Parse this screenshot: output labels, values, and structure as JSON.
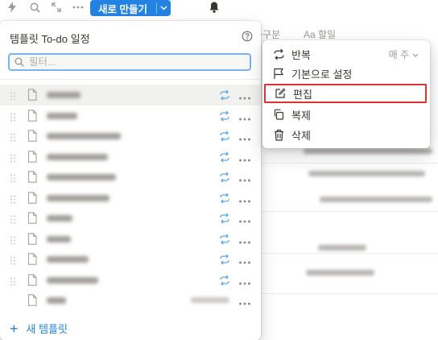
{
  "toolbar": {
    "icons": [
      "lightning-icon",
      "search-icon",
      "expand-icon",
      "more-icon"
    ],
    "new_button_label": "새로 만들기",
    "bell": "bell-icon",
    "accent": "#2383e2"
  },
  "background": {
    "col1_header": "구구분",
    "col2_header": "Aa 할일"
  },
  "panel": {
    "title": "템플릿 To-do 일정",
    "search_placeholder": "필터...",
    "new_template_label": "새 템플릿",
    "item_count": 11
  },
  "menu": {
    "items": [
      {
        "label": "반복",
        "icon": "repeat-icon",
        "value": "매 주"
      },
      {
        "label": "기본으로 설정",
        "icon": "flag-icon"
      },
      {
        "label": "편집",
        "icon": "edit-icon"
      },
      {
        "label": "복제",
        "icon": "duplicate-icon"
      },
      {
        "label": "삭제",
        "icon": "trash-icon"
      }
    ],
    "highlight_color": "#e03131"
  }
}
